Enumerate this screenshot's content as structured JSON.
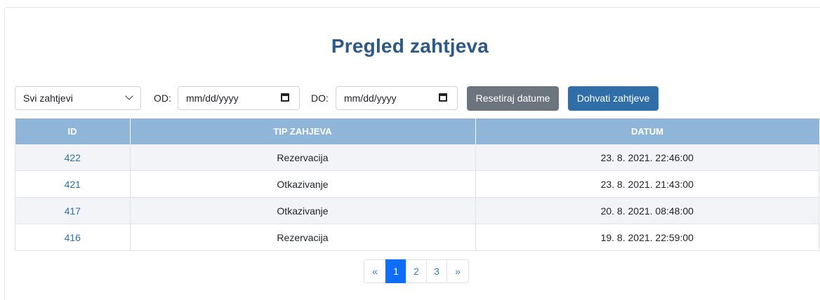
{
  "page": {
    "title": "Pregled zahtjeva"
  },
  "filters": {
    "type_select": {
      "selected": "Svi zahtjevi"
    },
    "from_label": "OD:",
    "from_placeholder": "mm/dd/yyyy",
    "to_label": "DO:",
    "to_placeholder": "mm/dd/yyyy",
    "reset_button": "Resetiraj datume",
    "fetch_button": "Dohvati zahtjeve"
  },
  "table": {
    "headers": [
      "ID",
      "TIP ZAHJEVA",
      "DATUM"
    ],
    "rows": [
      {
        "id": "422",
        "type": "Rezervacija",
        "date": "23. 8. 2021. 22:46:00"
      },
      {
        "id": "421",
        "type": "Otkazivanje",
        "date": "23. 8. 2021. 21:43:00"
      },
      {
        "id": "417",
        "type": "Otkazivanje",
        "date": "20. 8. 2021. 08:48:00"
      },
      {
        "id": "416",
        "type": "Rezervacija",
        "date": "19. 8. 2021. 22:59:00"
      }
    ]
  },
  "pagination": {
    "prev": "«",
    "pages": [
      "1",
      "2",
      "3"
    ],
    "active": "1",
    "next": "»"
  },
  "colors": {
    "title": "#2b5a8a",
    "header_bg": "#8fb6d8",
    "primary_button": "#2f6ea8",
    "secondary_button": "#6c757d",
    "active_page": "#0d6efd"
  }
}
